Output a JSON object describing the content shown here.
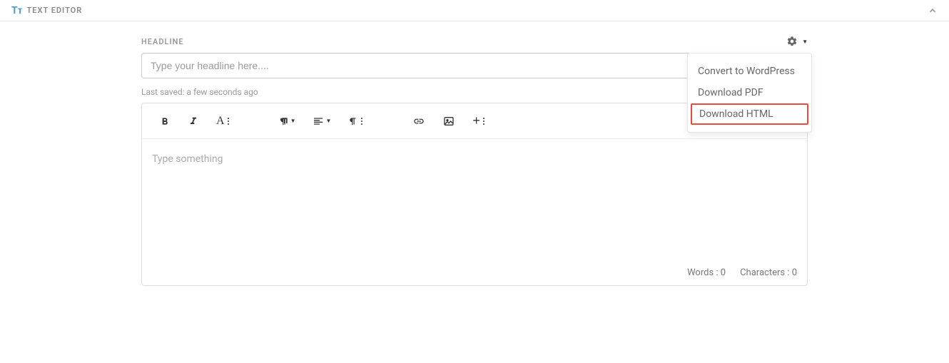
{
  "header": {
    "logo_glyph": "Tᴛ",
    "title": "TEXT EDITOR"
  },
  "headline": {
    "label": "HEADLINE",
    "placeholder": "Type your headline here...."
  },
  "saved": {
    "prefix": "Last saved: ",
    "value": "a few seconds ago"
  },
  "editor": {
    "placeholder": "Type something"
  },
  "footer": {
    "words_label": "Words :",
    "words_count": "0",
    "chars_label": "Characters :",
    "chars_count": "0"
  },
  "dropdown": {
    "items": [
      {
        "label": "Convert to WordPress",
        "highlighted": false
      },
      {
        "label": "Download PDF",
        "highlighted": false
      },
      {
        "label": "Download HTML",
        "highlighted": true
      }
    ]
  }
}
